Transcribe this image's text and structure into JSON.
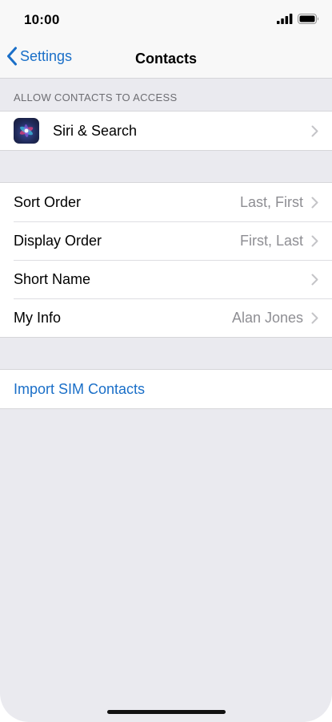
{
  "status_bar": {
    "time": "10:00",
    "icons": [
      "cellular-signal-icon",
      "battery-icon"
    ]
  },
  "nav": {
    "back_label": "Settings",
    "title": "Contacts",
    "back_icon": "chevron-left-icon"
  },
  "allow_section": {
    "header": "ALLOW CONTACTS TO ACCESS",
    "items": [
      {
        "label": "Siri & Search",
        "icon": "siri-icon"
      }
    ]
  },
  "settings_group": {
    "items": [
      {
        "label": "Sort Order",
        "value": "Last, First"
      },
      {
        "label": "Display Order",
        "value": "First, Last"
      },
      {
        "label": "Short Name",
        "value": ""
      },
      {
        "label": "My Info",
        "value": "Alan Jones"
      }
    ]
  },
  "import_group": {
    "label": "Import SIM Contacts"
  },
  "colors": {
    "accent": "#1a6fc8",
    "background": "#eaeaef",
    "secondary_text": "#8e8e93",
    "section_header": "#6d6d72",
    "separator": "#d6d6d9"
  }
}
